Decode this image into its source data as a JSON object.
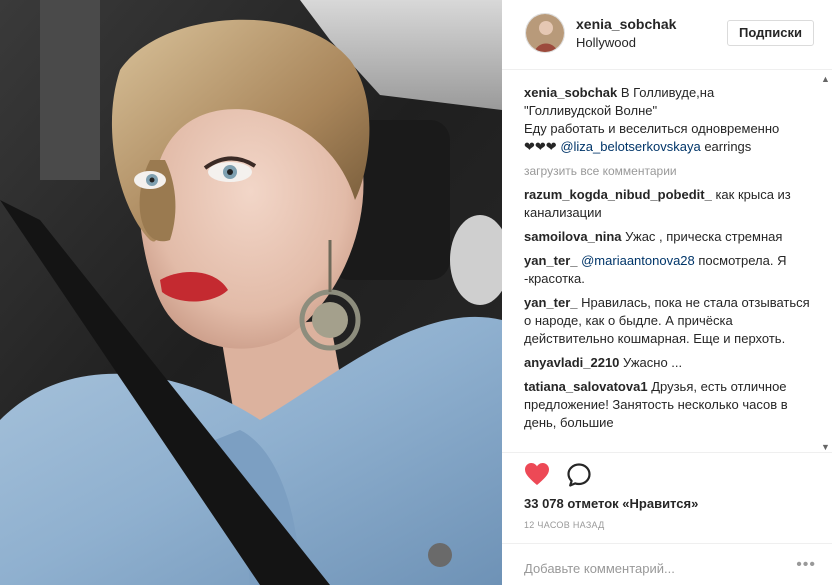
{
  "post": {
    "username": "xenia_sobchak",
    "location": "Hollywood",
    "follow_label": "Подписки",
    "caption": {
      "user": "xenia_sobchak",
      "line1": "В Голливуде,на",
      "line2": "\"Голливудской Волне\"",
      "line3": "Еду работать и веселиться одновременно",
      "hearts": "❤❤❤",
      "mention": "@liza_belotserkovskaya",
      "tail": "earrings"
    },
    "load_more": "загрузить все комментарии",
    "comments": [
      {
        "user": "razum_kogda_nibud_pobedit_",
        "text": "как крыса из канализации"
      },
      {
        "user": "samoilova_nina",
        "text": "Ужас , прическа стремная"
      },
      {
        "user": "yan_ter_",
        "mention": "@mariaantonova28",
        "text": "посмотрела. Я -красотка."
      },
      {
        "user": "yan_ter_",
        "text": "Нравилась, пока не стала отзываться о народе, как о быдле. А причёска действительно кошмарная. Еще и перхоть."
      },
      {
        "user": "anyavladi_2210",
        "text": "Ужасно ..."
      },
      {
        "user": "tatiana_salovatova1",
        "text": "Друзья, есть отличное предложение! Занятость несколько часов в день, большие"
      }
    ],
    "likes": "33 078 отметок «Нравится»",
    "timestamp": "12 ЧАСОВ НАЗАД",
    "add_comment_placeholder": "Добавьте комментарий...",
    "more_label": "•••"
  },
  "icons": {
    "heart": "heart-icon",
    "comment": "comment-icon",
    "more": "more-options-icon"
  },
  "colors": {
    "heart": "#ed4956",
    "text": "#262626",
    "muted": "#999999",
    "mention": "#003569"
  }
}
